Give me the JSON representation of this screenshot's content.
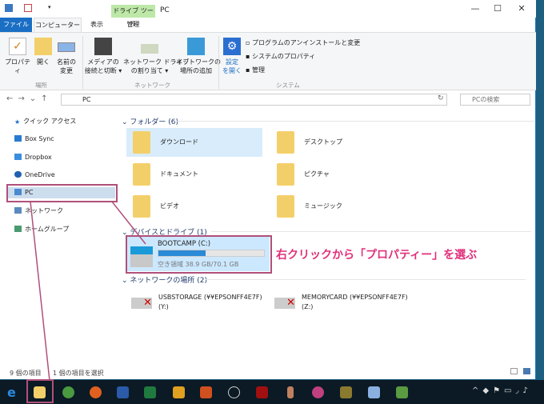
{
  "window": {
    "title": "PC",
    "context_tab": "ドライブ ツール"
  },
  "tabs": [
    "ファイル",
    "コンピューター",
    "表示",
    "管理"
  ],
  "ribbon": {
    "location_buttons": [
      "プロパティ",
      "開く",
      "名前の\n変更"
    ],
    "location_group": "場所",
    "network_buttons": [
      "メディアの\n接続と切断 ▾",
      "ネットワーク ドライブ\nの割り当て ▾",
      "ネットワークの\n場所の追加"
    ],
    "network_group": "ネットワーク",
    "settings_button": "設定\nを開く",
    "system_items": [
      "プログラムのアンインストールと変更",
      "システムのプロパティ",
      "管理"
    ],
    "system_group": "システム"
  },
  "address": {
    "path": "PC",
    "search_placeholder": "PCの検索"
  },
  "nav": [
    "クイック アクセス",
    "Box Sync",
    "Dropbox",
    "OneDrive",
    "PC",
    "ネットワーク",
    "ホームグループ"
  ],
  "sections": {
    "folders": "フォルダー (6)",
    "devices": "デバイスとドライブ (1)",
    "network": "ネットワークの場所 (2)"
  },
  "folders": [
    "ダウンロード",
    "デスクトップ",
    "ドキュメント",
    "ピクチャ",
    "ビデオ",
    "ミュージック"
  ],
  "drive": {
    "name": "BOOTCAMP (C:)",
    "free": "空き領域 38.9 GB/70.1 GB",
    "used_fraction": 0.445
  },
  "network_locations": [
    {
      "name": "USBSTORAGE (¥¥EPSONFF4E7F)",
      "letter": "(Y:)"
    },
    {
      "name": "MEMORYCARD (¥¥EPSONFF4E7F)",
      "letter": "(Z:)"
    }
  ],
  "status": {
    "count": "9 個の項目",
    "selected": "1 個の項目を選択"
  },
  "annotation": "右クリックから「プロパティー」を選ぶ",
  "colors": {
    "accent": "#1a6fc4",
    "annotation": "#e0307a",
    "selection": "#cce8ff"
  }
}
